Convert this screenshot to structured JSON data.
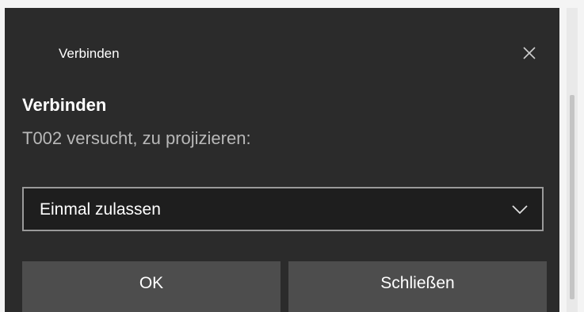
{
  "dialog": {
    "titlebar_title": "Verbinden",
    "heading": "Verbinden",
    "message": "T002 versucht, zu projizieren:",
    "close_icon": "close-icon",
    "select": {
      "selected_value": "Einmal zulassen",
      "chevron_icon": "chevron-down-icon"
    },
    "buttons": {
      "ok_label": "OK",
      "close_label": "Schließen"
    }
  },
  "colors": {
    "dialog_background": "#2b2b2b",
    "select_background": "#1e1e1e",
    "select_border": "#9a9a9a",
    "button_background": "#4d4d4d",
    "secondary_text": "#b8b8b8"
  }
}
